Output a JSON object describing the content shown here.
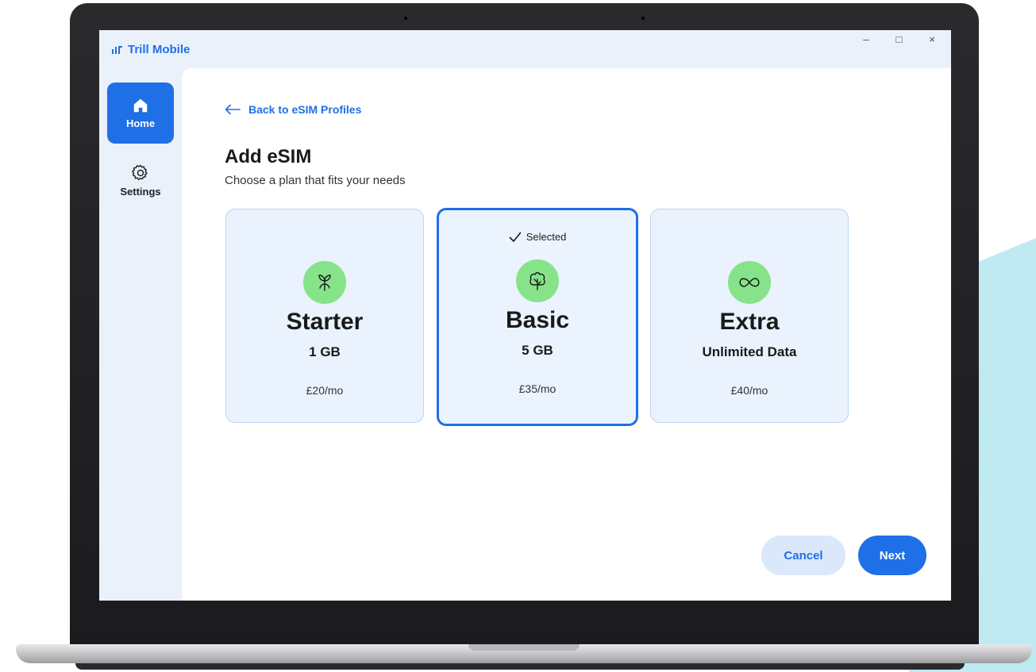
{
  "app": {
    "name": "Trill Mobile"
  },
  "window_controls": {
    "minimize": "–",
    "maximize": "□",
    "close": "×"
  },
  "sidebar": {
    "items": [
      {
        "label": "Home",
        "icon": "home-icon",
        "active": true
      },
      {
        "label": "Settings",
        "icon": "gear-icon",
        "active": false
      }
    ]
  },
  "main": {
    "back_link": "Back to eSIM Profiles",
    "title": "Add eSIM",
    "subtitle": "Choose a plan that fits your needs",
    "selected_label": "Selected",
    "plans": [
      {
        "name": "Starter",
        "data": "1 GB",
        "price": "£20/mo",
        "icon": "sprout-icon",
        "selected": false
      },
      {
        "name": "Basic",
        "data": "5 GB",
        "price": "£35/mo",
        "icon": "tree-icon",
        "selected": true
      },
      {
        "name": "Extra",
        "data": "Unlimited Data",
        "price": "£40/mo",
        "icon": "infinity-icon",
        "selected": false
      }
    ]
  },
  "actions": {
    "cancel": "Cancel",
    "next": "Next"
  },
  "colors": {
    "accent": "#1f6fe6",
    "plan_icon_bg": "#86e389",
    "card_bg": "#eaf2fd",
    "app_bg": "#eaf1fb"
  }
}
